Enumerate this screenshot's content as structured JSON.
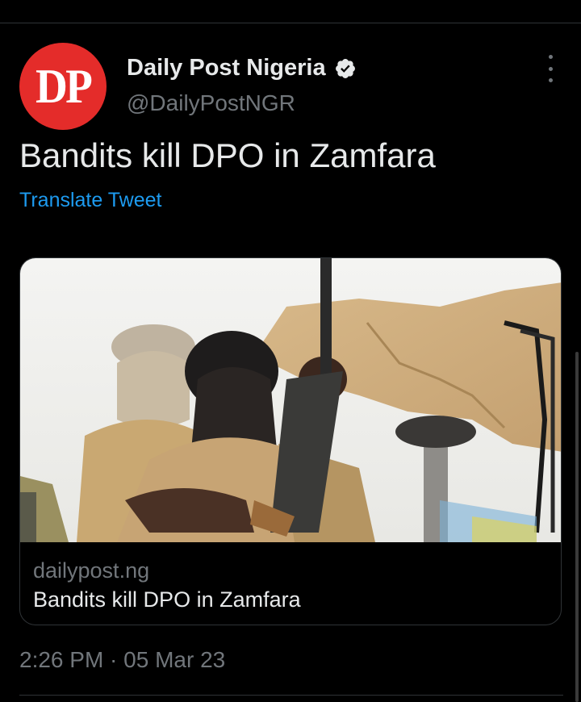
{
  "account": {
    "avatar_text": "DP",
    "display_name": "Daily Post Nigeria",
    "handle": "@DailyPostNGR",
    "verified": true
  },
  "tweet": {
    "text": "Bandits kill DPO in Zamfara",
    "translate_label": "Translate Tweet",
    "timestamp": "2:26 PM · 05 Mar 23"
  },
  "link_card": {
    "domain": "dailypost.ng",
    "title": "Bandits kill DPO in Zamfara",
    "image_icon": "news-photo"
  },
  "icons": {
    "verified": "verified-badge-icon",
    "more": "more-options-icon"
  },
  "colors": {
    "background": "#000000",
    "text_primary": "#e7e9ea",
    "text_secondary": "#71767b",
    "link": "#1d9bf0",
    "avatar_bg": "#e42c2a",
    "divider": "#2f3336"
  }
}
